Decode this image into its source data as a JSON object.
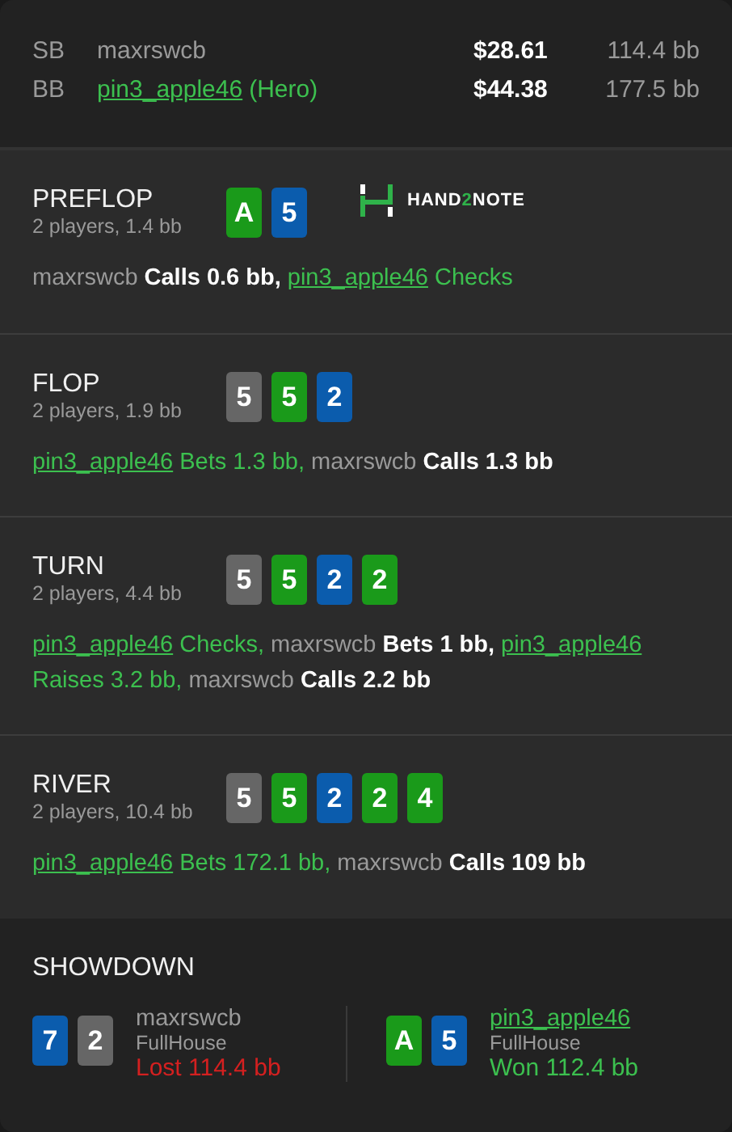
{
  "players": [
    {
      "position": "SB",
      "name": "maxrswcb",
      "hero": false,
      "stack": "$28.61",
      "bb": "114.4 bb"
    },
    {
      "position": "BB",
      "name": "pin3_apple46",
      "hero": true,
      "hero_tag": "(Hero)",
      "stack": "$44.38",
      "bb": "177.5 bb"
    }
  ],
  "streets": [
    {
      "name": "PREFLOP",
      "info": "2 players, 1.4 bb",
      "logo": {
        "before": "HAND",
        "accent": "2",
        "after": "NOTE"
      },
      "cards": [
        {
          "rank": "A",
          "color": "#1a9a1a"
        },
        {
          "rank": "5",
          "color": "#0b5cad"
        }
      ],
      "actions": [
        {
          "player": "maxrswcb",
          "hero": false,
          "action": "Calls 0.6 bb,"
        },
        {
          "player": "pin3_apple46",
          "hero": true,
          "action": "Checks"
        }
      ]
    },
    {
      "name": "FLOP",
      "info": "2 players, 1.9 bb",
      "cards": [
        {
          "rank": "5",
          "color": "#666666"
        },
        {
          "rank": "5",
          "color": "#1a9a1a"
        },
        {
          "rank": "2",
          "color": "#0b5cad"
        }
      ],
      "actions": [
        {
          "player": "pin3_apple46",
          "hero": true,
          "action": "Bets 1.3 bb,"
        },
        {
          "player": "maxrswcb",
          "hero": false,
          "action": "Calls 1.3 bb"
        }
      ]
    },
    {
      "name": "TURN",
      "info": "2 players, 4.4 bb",
      "cards": [
        {
          "rank": "5",
          "color": "#666666"
        },
        {
          "rank": "5",
          "color": "#1a9a1a"
        },
        {
          "rank": "2",
          "color": "#0b5cad"
        },
        {
          "rank": "2",
          "color": "#1a9a1a"
        }
      ],
      "actions": [
        {
          "player": "pin3_apple46",
          "hero": true,
          "action": "Checks,"
        },
        {
          "player": "maxrswcb",
          "hero": false,
          "action": "Bets 1 bb,"
        },
        {
          "player": "pin3_apple46",
          "hero": true,
          "action": "Raises 3.2 bb,"
        },
        {
          "player": "maxrswcb",
          "hero": false,
          "action": "Calls 2.2 bb"
        }
      ]
    },
    {
      "name": "RIVER",
      "info": "2 players, 10.4 bb",
      "cards": [
        {
          "rank": "5",
          "color": "#666666"
        },
        {
          "rank": "5",
          "color": "#1a9a1a"
        },
        {
          "rank": "2",
          "color": "#0b5cad"
        },
        {
          "rank": "2",
          "color": "#1a9a1a"
        },
        {
          "rank": "4",
          "color": "#1a9a1a"
        }
      ],
      "actions": [
        {
          "player": "pin3_apple46",
          "hero": true,
          "action": "Bets 172.1 bb,"
        },
        {
          "player": "maxrswcb",
          "hero": false,
          "action": "Calls 109 bb"
        }
      ]
    }
  ],
  "showdown": {
    "title": "SHOWDOWN",
    "hands": [
      {
        "cards": [
          {
            "rank": "7",
            "color": "#0b5cad"
          },
          {
            "rank": "2",
            "color": "#666666"
          }
        ],
        "player": "maxrswcb",
        "hero": false,
        "hand": "FullHouse",
        "result": "Lost 114.4 bb",
        "won": false
      },
      {
        "cards": [
          {
            "rank": "A",
            "color": "#1a9a1a"
          },
          {
            "rank": "5",
            "color": "#0b5cad"
          }
        ],
        "player": "pin3_apple46",
        "hero": true,
        "hand": "FullHouse",
        "result": "Won 112.4 bb",
        "won": true
      }
    ]
  }
}
